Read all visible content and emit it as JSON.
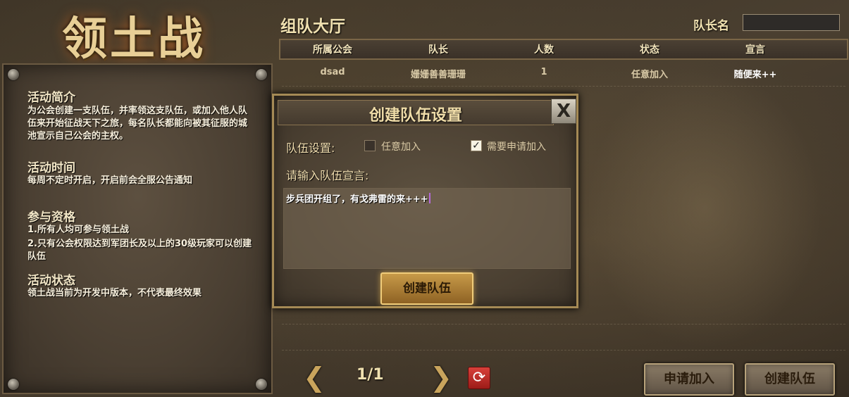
{
  "title_logo": "领土战",
  "info": {
    "intro_heading": "活动简介",
    "intro_text": "为公会创建一支队伍，并率领这支队伍，或加入他人队伍来开始征战天下之旅，每名队长都能向被其征服的城池宣示自己公会的主权。",
    "time_heading": "活动时间",
    "time_text": "每周不定时开启，开启前会全服公告通知",
    "qual_heading": "参与资格",
    "qual_line1": "1.所有人均可参与领土战",
    "qual_line2": "2.只有公会权限达到军团长及以上的30级玩家可以创建队伍",
    "status_heading": "活动状态",
    "status_text": "领土战当前为开发中版本，不代表最终效果"
  },
  "lobby": {
    "title": "组队大厅",
    "captain_label": "队长名",
    "captain_value": "",
    "columns": [
      "所属公会",
      "队长",
      "人数",
      "状态",
      "宣言"
    ],
    "rows": [
      {
        "guild": "dsad",
        "captain": "姗姗善善珊珊",
        "count": "1",
        "status": "任意加入",
        "declaration": "随便来++"
      }
    ]
  },
  "pagination": {
    "page": "1/1",
    "prev_icon": "chevron-left-icon",
    "next_icon": "chevron-right-icon",
    "refresh_icon": "refresh-icon"
  },
  "buttons": {
    "apply_join": "申请加入",
    "create_team": "创建队伍"
  },
  "modal": {
    "title": "创建队伍设置",
    "close_label": "X",
    "team_settings_label": "队伍设置:",
    "option_free_join": "任意加入",
    "option_free_join_checked": false,
    "option_apply_join": "需要申请加入",
    "option_apply_join_checked": true,
    "declaration_label": "请输入队伍宣言:",
    "declaration_value": "步兵团开组了，有戈弗雷的来+++",
    "create_button": "创建队伍"
  }
}
